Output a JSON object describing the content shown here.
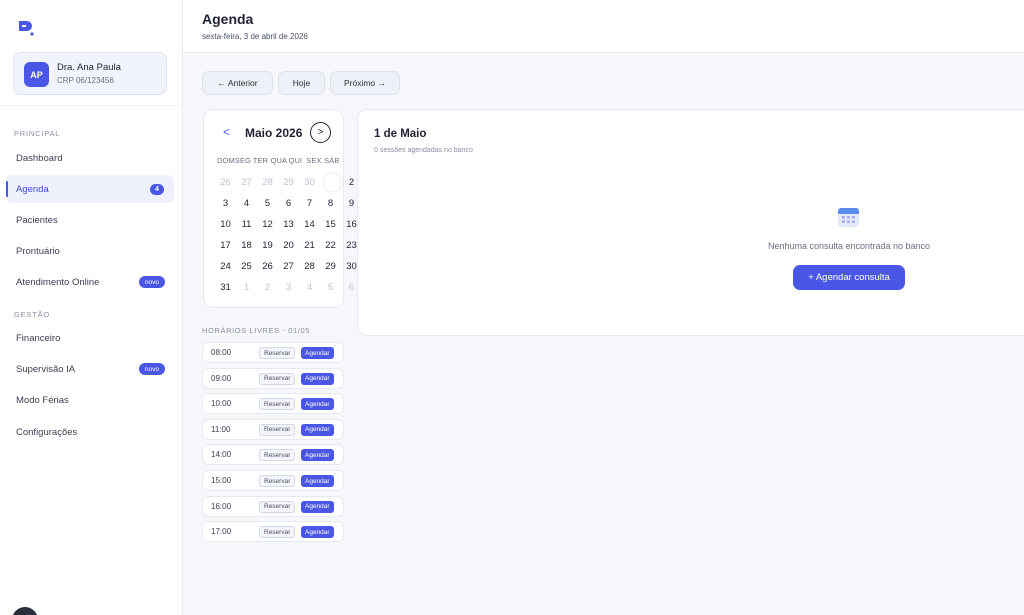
{
  "brand": {
    "logo_icon": "logo-icon",
    "accent": "#4a57e6"
  },
  "profile": {
    "initials": "AP",
    "name": "Dra. Ana Paula",
    "crp": "CRP 06/123456"
  },
  "sidebar": {
    "section_principal": "PRINCIPAL",
    "section_gestao": "GESTÃO",
    "items": [
      {
        "label": "Dashboard"
      },
      {
        "label": "Agenda",
        "badge": "4"
      },
      {
        "label": "Pacientes"
      },
      {
        "label": "Prontuário"
      },
      {
        "label": "Atendimento Online",
        "pill": "novo"
      },
      {
        "label": "Financeiro"
      },
      {
        "label": "Supervisão IA",
        "pill": "novo"
      },
      {
        "label": "Modo Férias"
      },
      {
        "label": "Configurações"
      }
    ]
  },
  "header": {
    "title": "Agenda",
    "date": "sexta-feira, 3 de abril de 2026"
  },
  "navigation": {
    "prev": "← Anterior",
    "today": "Hoje",
    "next": "Próximo →"
  },
  "calendar": {
    "prev_label": "<",
    "month": "Maio 2026",
    "next_label": ">",
    "weekdays": [
      "DOM",
      "SEG",
      "TER",
      "QUA",
      "QUI",
      "SEX",
      "SÁB"
    ],
    "days": [
      {
        "d": "26",
        "muted": true
      },
      {
        "d": "27",
        "muted": true
      },
      {
        "d": "28",
        "muted": true
      },
      {
        "d": "29",
        "muted": true
      },
      {
        "d": "30",
        "muted": true
      },
      {
        "d": "",
        "selected": true
      },
      {
        "d": "2"
      },
      {
        "d": "3"
      },
      {
        "d": "4"
      },
      {
        "d": "5"
      },
      {
        "d": "6"
      },
      {
        "d": "7"
      },
      {
        "d": "8"
      },
      {
        "d": "9"
      },
      {
        "d": "10"
      },
      {
        "d": "11"
      },
      {
        "d": "12"
      },
      {
        "d": "13"
      },
      {
        "d": "14"
      },
      {
        "d": "15"
      },
      {
        "d": "16"
      },
      {
        "d": "17"
      },
      {
        "d": "18"
      },
      {
        "d": "19"
      },
      {
        "d": "20"
      },
      {
        "d": "21"
      },
      {
        "d": "22"
      },
      {
        "d": "23"
      },
      {
        "d": "24"
      },
      {
        "d": "25"
      },
      {
        "d": "26"
      },
      {
        "d": "27"
      },
      {
        "d": "28"
      },
      {
        "d": "29"
      },
      {
        "d": "30"
      },
      {
        "d": "31"
      },
      {
        "d": "1",
        "muted": true
      },
      {
        "d": "2",
        "muted": true
      },
      {
        "d": "3",
        "muted": true
      },
      {
        "d": "4",
        "muted": true
      },
      {
        "d": "5",
        "muted": true
      },
      {
        "d": "6",
        "muted": true
      }
    ]
  },
  "free_slots": {
    "title": "HORÁRIOS LIVRES - 01/05",
    "reserve_label": "Reservar",
    "book_label": "Agendar",
    "times": [
      "08:00",
      "09:00",
      "10:00",
      "11:00",
      "14:00",
      "15:00",
      "16:00",
      "17:00"
    ]
  },
  "day_panel": {
    "title": "1 de Maio",
    "subtitle": "0 sessões agendadas no banco",
    "empty_icon": "calendar-icon",
    "empty_text": "Nenhuma consulta encontrada no banco",
    "action_label": "+ Agendar consulta"
  }
}
